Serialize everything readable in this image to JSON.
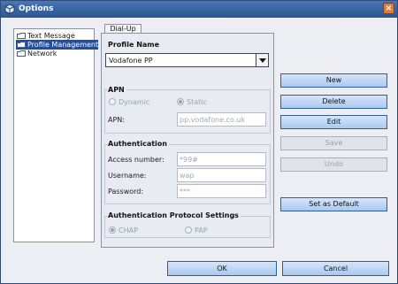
{
  "window": {
    "title": "Options"
  },
  "tree": {
    "items": [
      {
        "label": "Text Message"
      },
      {
        "label": "Profile Management"
      },
      {
        "label": "Network"
      }
    ]
  },
  "tab": {
    "label": "Dial-Up"
  },
  "profile": {
    "group_title": "Profile Name",
    "selected": "Vodafone PP"
  },
  "apn": {
    "group_title": "APN",
    "dynamic_label": "Dynamic",
    "static_label": "Static",
    "field_label": "APN:",
    "value": "pp.vodafone.co.uk"
  },
  "auth": {
    "group_title": "Authentication",
    "access_label": "Access number:",
    "access_value": "*99#",
    "username_label": "Username:",
    "username_value": "wap",
    "password_label": "Password:",
    "password_value": "***"
  },
  "protocol": {
    "group_title": "Authentication Protocol Settings",
    "chap_label": "CHAP",
    "pap_label": "PAP"
  },
  "buttons": {
    "new": "New",
    "delete": "Delete",
    "edit": "Edit",
    "save": "Save",
    "undo": "Undo",
    "set_default": "Set as Default",
    "ok": "OK",
    "cancel": "Cancel"
  },
  "colors": {
    "title_bar": "#2c568f",
    "selection": "#1f4fa4",
    "button": "#aac8ef"
  }
}
